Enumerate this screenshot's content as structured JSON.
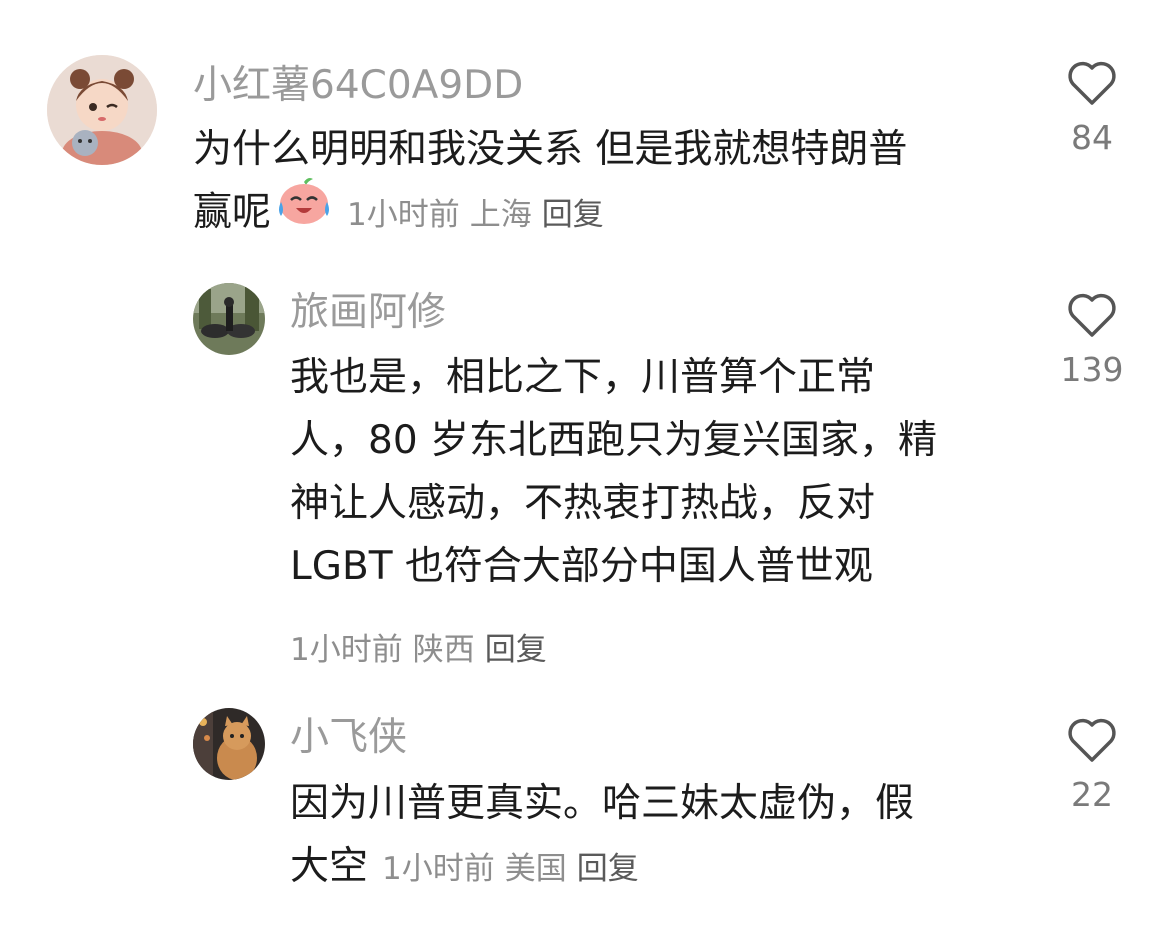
{
  "comments": [
    {
      "username": "小红薯64C0A9DD",
      "text": "为什么明明和我没关系 但是我就想特朗普赢呢",
      "emoji": "crying-laughing-peach-emoji",
      "time": "1小时前",
      "location": "上海",
      "reply_label": "回复",
      "likes": "84"
    },
    {
      "username": "旅画阿修",
      "text": "我也是，相比之下，川普算个正常人，80岁东北西跑只为复兴国家，精神让人感动，不热衷打热战，反对LGBT也符合大部分中国人普世观",
      "time": "1小时前",
      "location": "陕西",
      "reply_label": "回复",
      "likes": "139"
    },
    {
      "username": "小飞侠",
      "text": "因为川普更真实。哈三妹太虚伪，假大空",
      "time": "1小时前",
      "location": "美国",
      "reply_label": "回复",
      "likes": "22"
    }
  ]
}
